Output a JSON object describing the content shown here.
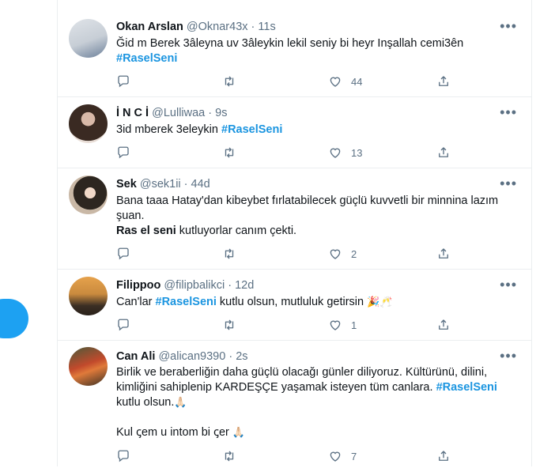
{
  "tweets": [
    {
      "name": "Okan Arslan",
      "handle": "@Oknar43x",
      "sep": "·",
      "time": "11s",
      "line1": "Ğid m Berek 3âleyna uv 3âleykin lekil seniy bi heyr Inşallah cemi3ên",
      "hashtag": "#RaselSeni",
      "likes": "44",
      "avatar_colors": [
        "#d9dde3",
        "#6b7f99"
      ]
    },
    {
      "name": "İ N C İ",
      "handle": "@Lulliwaa",
      "sep": "·",
      "time": "9s",
      "text": "3id mberek 3eleykin ",
      "hashtag": "#RaselSeni",
      "likes": "13",
      "avatar_colors": [
        "#e8ddd6",
        "#3a2a22"
      ]
    },
    {
      "name": "Sek",
      "handle": "@sek1ii",
      "sep": "·",
      "time": "44d",
      "line1": "Bana taaa Hatay'dan kibeybet fırlatabilecek güçlü kuvvetli bir minnina lazım",
      "line2": "şuan.",
      "bold_text": "Ras el seni",
      "line3_rest": " kutluyorlar canım çekti.",
      "likes": "2",
      "avatar_colors": [
        "#c9b8a6",
        "#2d2620"
      ]
    },
    {
      "name": "Filippoo",
      "handle": "@filipbalikci",
      "sep": "·",
      "time": "12d",
      "text_before": "Can'lar ",
      "hashtag": "#RaselSeni",
      "text_after": " kutlu olsun, mutluluk getirsin ",
      "emoji": "🎉🥂",
      "likes": "1",
      "avatar_colors": [
        "#e6a24c",
        "#3b2e24"
      ]
    },
    {
      "name": "Can Ali",
      "handle": "@alican9390",
      "sep": "·",
      "time": "2s",
      "line1": "Birlik ve beraberliğin daha güçlü olacağı günler diliyoruz. Kültürünü, dilini,",
      "line2_text": "kimliğini sahiplenip KARDEŞÇE yaşamak isteyen tüm canlara. ",
      "hashtag": "#RaselSeni",
      "line3": "kutlu olsun.",
      "line3_emoji": "🙏🏻",
      "line4": "Kul ꞔem u intom bi ꞔer ",
      "line4_emoji": "🙏🏻",
      "likes": "7",
      "avatar_colors": [
        "#c24a2c",
        "#4a5a3a"
      ]
    }
  ],
  "colors": {
    "accent": "#1da1f2",
    "hashtag": "#1b95e0",
    "muted": "#5b7083",
    "border": "#ebeef0"
  },
  "icons": {
    "reply": "reply-icon",
    "retweet": "retweet-icon",
    "like": "heart-icon",
    "share": "share-icon",
    "more": "more-icon",
    "compose": "compose-button"
  }
}
